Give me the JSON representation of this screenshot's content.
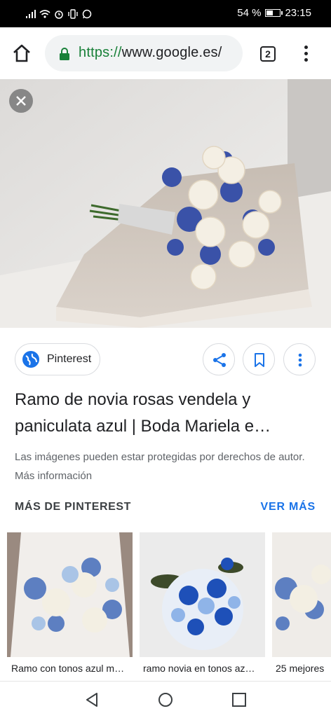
{
  "status_bar": {
    "battery": "54 %",
    "battery_level": 0.54,
    "time": "23:15"
  },
  "browser": {
    "url_scheme": "https://",
    "url_host": "www.google.es/",
    "tab_count": "2"
  },
  "image_viewer": {
    "source_name": "Pinterest",
    "title_line1": "Ramo de novia rosas vendela y",
    "title_line2": "paniculata azul | Boda Mariela e…",
    "copyright_notice": "Las imágenes pueden estar protegidas por derechos de autor. Más información"
  },
  "related": {
    "section_title": "MÁS DE PINTEREST",
    "more_link": "VER MÁS",
    "items": [
      {
        "caption": "Ramo con tonos azul m…"
      },
      {
        "caption": "ramo novia en tonos az…"
      },
      {
        "caption": "25 mejores"
      }
    ]
  },
  "icons": {
    "home": "home-icon",
    "lock": "lock-icon",
    "menu": "more-vert-icon",
    "close": "close-icon",
    "share": "share-icon",
    "save": "bookmark-icon",
    "more": "more-vert-icon",
    "nav": [
      "back-icon",
      "home-circle-icon",
      "recents-square-icon"
    ]
  },
  "colors": {
    "link": "#1a73e8",
    "secure": "#188038",
    "text": "#202124",
    "secondary_text": "#5f6368"
  }
}
